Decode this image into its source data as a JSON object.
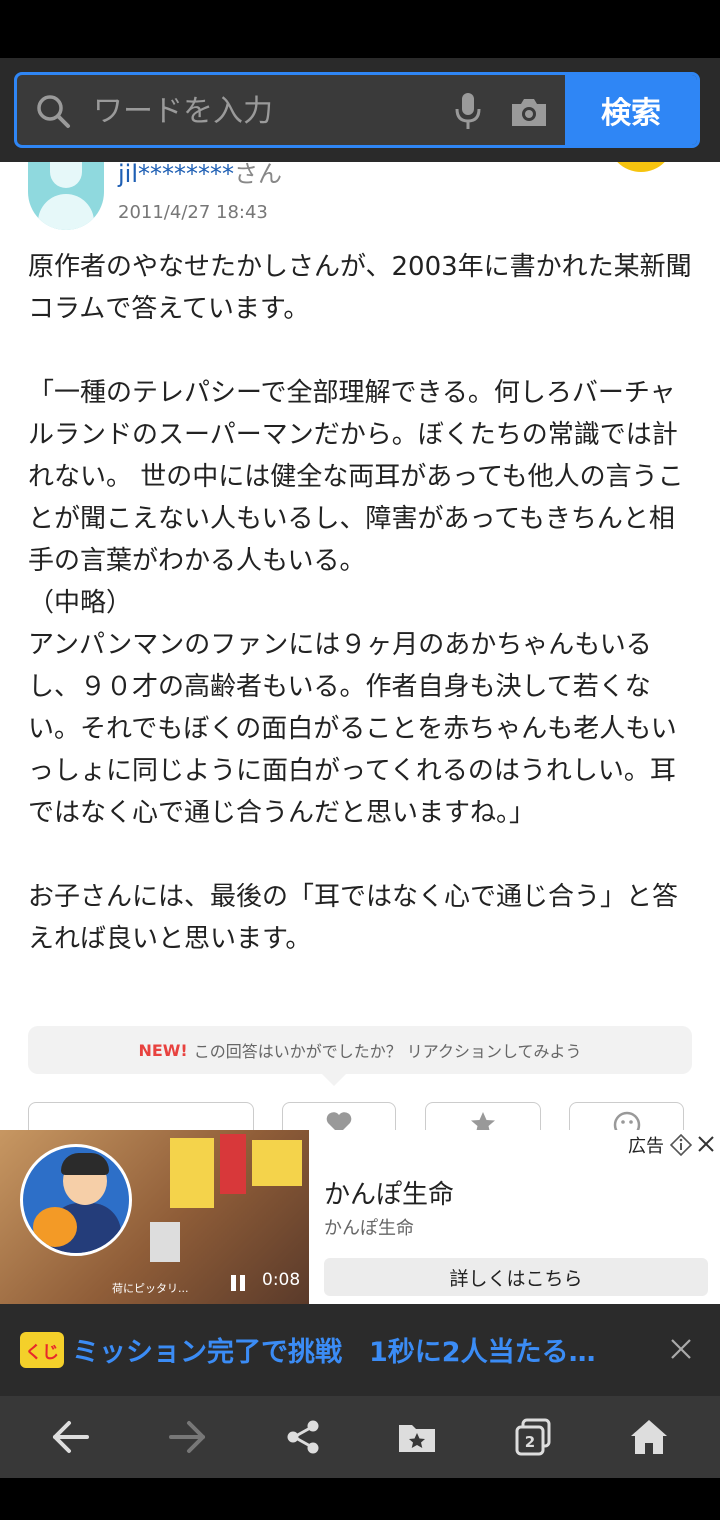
{
  "search": {
    "placeholder": "ワードを入力",
    "button_label": "検索"
  },
  "answer": {
    "user_name": "jil********",
    "user_suffix": "さん",
    "date": "2011/4/27 18:43",
    "body": "原作者のやなせたかしさんが、2003年に書かれた某新聞コラムで答えています。\n\n「一種のテレパシーで全部理解できる。何しろバーチャルランドのスーパーマンだから。ぼくたちの常識では計れない。 世の中には健全な両耳があっても他人の言うことが聞こえない人もいるし、障害があってもきちんと相手の言葉がわかる人もいる。\n（中略）\nアンパンマンのファンには９ヶ月のあかちゃんもいるし、９０才の高齢者もいる。作者自身も決して若くない。それでもぼくの面白がることを赤ちゃんも老人もいっしょに同じように面白がってくれるのはうれしい。耳ではなく心で通じ合うんだと思いますね。」\n\nお子さんには、最後の「耳ではなく心で通じ合う」と答えれば良いと思います。"
  },
  "reaction": {
    "new_badge": "NEW!",
    "prompt": "この回答はいかがでしたか？ リアクションしてみよう"
  },
  "ad": {
    "label": "広告",
    "title": "かんぽ生命",
    "advertiser": "かんぽ生命",
    "cta": "詳しくはこちら",
    "video_time": "0:08",
    "video_caption": "荷にピッタリ..."
  },
  "banner": {
    "logo_text": "くじ",
    "text": "ミッション完了で挑戦　1秒に2人当たる…"
  },
  "nav": {
    "tab_count": "2"
  },
  "colors": {
    "accent": "#2f86f5",
    "username": "#1e5fb4",
    "new_badge": "#e8423f",
    "banner_text": "#3b8cf5"
  }
}
